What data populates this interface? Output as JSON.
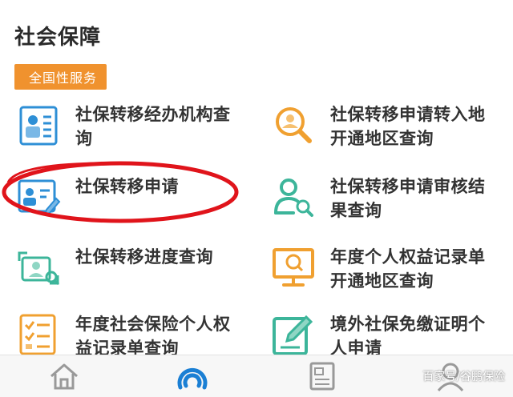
{
  "section": {
    "title": "社会保障",
    "tag": "全国性服务"
  },
  "items": [
    {
      "label": "社保转移经办机构查询",
      "icon": "id-card-icon"
    },
    {
      "label": "社保转移申请转入地开通地区查询",
      "icon": "search-person-icon"
    },
    {
      "label": "社保转移申请",
      "icon": "id-card-pen-icon"
    },
    {
      "label": "社保转移申请审核结果查询",
      "icon": "person-search-icon"
    },
    {
      "label": "社保转移进度查询",
      "icon": "transfer-progress-icon"
    },
    {
      "label": "年度个人权益记录单开通地区查询",
      "icon": "monitor-search-icon"
    },
    {
      "label": "年度社会保险个人权益记录单查询",
      "icon": "checklist-icon"
    },
    {
      "label": "境外社保免缴证明个人申请",
      "icon": "edit-document-icon"
    }
  ],
  "tabbar": [
    "home-icon",
    "service-icon",
    "news-icon",
    "profile-icon"
  ],
  "watermark": "百家号/谷鹏保险",
  "colors": {
    "accent": "#f0922e",
    "blue": "#2e8fd6",
    "green": "#3cb59a",
    "orange": "#f0a030",
    "annotation": "#e0141b"
  }
}
